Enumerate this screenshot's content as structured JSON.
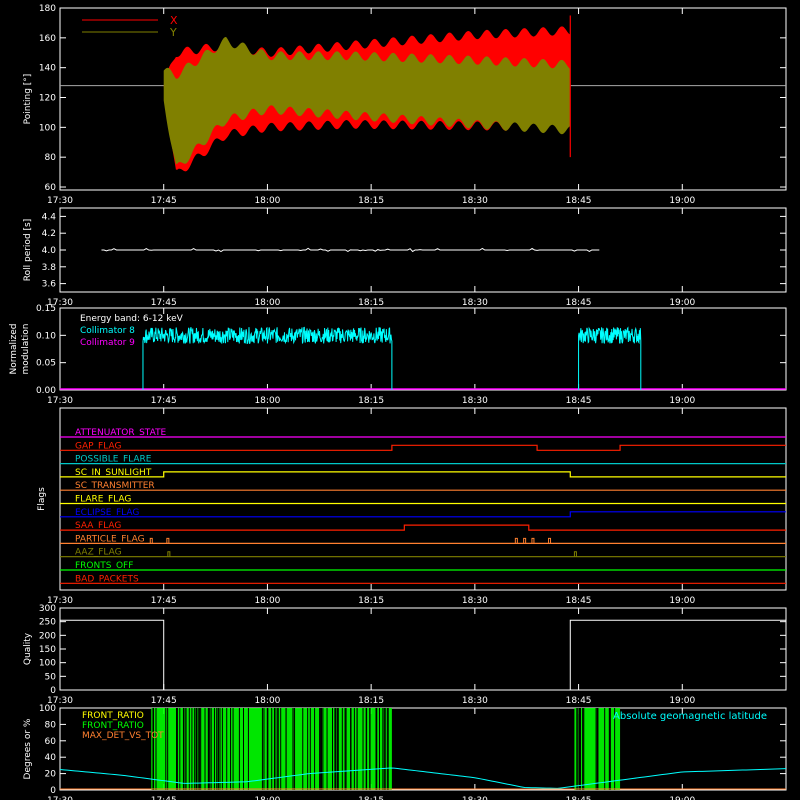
{
  "time_ticks": [
    "17:30",
    "17:45",
    "18:00",
    "18:15",
    "18:30",
    "18:45",
    "19:00"
  ],
  "chart_data": [
    {
      "type": "area",
      "panel": "pointing",
      "ylabel": "Pointing [°]",
      "ylim": [
        58,
        180
      ],
      "yticks": [
        60,
        80,
        100,
        120,
        140,
        160,
        180
      ],
      "reference_line": 128,
      "legend_placement": "top-left",
      "series": [
        {
          "name": "X",
          "color": "#ff0000",
          "band_min": [
            [
              17.75,
              128
            ],
            [
              17.78,
              68
            ],
            [
              17.9,
              95
            ],
            [
              18.0,
              100
            ],
            [
              18.2,
              102
            ],
            [
              18.5,
              101
            ],
            [
              18.73,
              100
            ]
          ],
          "band_max": [
            [
              17.75,
              128
            ],
            [
              17.78,
              150
            ],
            [
              17.9,
              155
            ],
            [
              18.0,
              150
            ],
            [
              18.2,
              155
            ],
            [
              18.5,
              162
            ],
            [
              18.73,
              165
            ]
          ]
        },
        {
          "name": "Y",
          "color": "#808000",
          "band_min": [
            [
              17.75,
              118
            ],
            [
              17.78,
              72
            ],
            [
              17.9,
              105
            ],
            [
              18.0,
              112
            ],
            [
              18.2,
              108
            ],
            [
              18.5,
              102
            ],
            [
              18.73,
              98
            ]
          ],
          "band_max": [
            [
              17.75,
              138
            ],
            [
              17.78,
              135
            ],
            [
              17.9,
              158
            ],
            [
              18.0,
              148
            ],
            [
              18.2,
              148
            ],
            [
              18.5,
              145
            ],
            [
              18.73,
              142
            ]
          ]
        }
      ]
    },
    {
      "type": "line",
      "panel": "roll_period",
      "ylabel": "Roll period [s]",
      "ylim": [
        3.5,
        4.5
      ],
      "yticks": [
        "3.6",
        "3.8",
        "4.0",
        "4.2",
        "4.4"
      ],
      "series": [
        {
          "color": "#ffffff",
          "value": 4.0,
          "x_range": [
            17.6,
            18.8
          ]
        }
      ]
    },
    {
      "type": "line",
      "panel": "modulation",
      "ylabel_lines": [
        "Normalized",
        "modulation"
      ],
      "ylim": [
        0,
        0.15
      ],
      "yticks": [
        "0.00",
        "0.05",
        "0.10",
        "0.15"
      ],
      "annotation": "Energy band: 6-12 keV",
      "series": [
        {
          "name": "Collimator 8",
          "color": "#00ffff",
          "mean": 0.1,
          "segments": [
            [
              17.7,
              18.3
            ],
            [
              18.75,
              18.9
            ]
          ]
        },
        {
          "name": "Collimator 9",
          "color": "#ff00ff",
          "value": 0.0
        }
      ]
    },
    {
      "type": "line",
      "panel": "flags",
      "ylabel": "Flags",
      "flags": [
        {
          "name": "ATTENUATOR_STATE",
          "color": "#ff00ff",
          "changes": []
        },
        {
          "name": "GAP_FLAG",
          "color": "#ff2000",
          "changes": [
            [
              17.7,
              1
            ],
            [
              18.3,
              2
            ],
            [
              18.65,
              1
            ],
            [
              18.85,
              2
            ]
          ]
        },
        {
          "name": "POSSIBLE_FLARE",
          "color": "#00c8c8",
          "changes": []
        },
        {
          "name": "SC_IN_SUNLIGHT",
          "color": "#ffff00",
          "changes": [
            [
              17.75,
              2
            ],
            [
              18.73,
              1
            ]
          ]
        },
        {
          "name": "SC_TRANSMITTER",
          "color": "#ff8030",
          "changes": []
        },
        {
          "name": "FLARE_FLAG",
          "color": "#ffff00",
          "changes": []
        },
        {
          "name": "ECLIPSE_FLAG",
          "color": "#0000ff",
          "changes": [
            [
              17.75,
              1
            ],
            [
              18.73,
              2
            ]
          ]
        },
        {
          "name": "SAA_FLAG",
          "color": "#ff2000",
          "changes": [
            [
              18.33,
              2
            ],
            [
              18.63,
              1
            ]
          ]
        },
        {
          "name": "PARTICLE_FLAG",
          "color": "#ff8030",
          "changes": []
        },
        {
          "name": "AAZ_FLAG",
          "color": "#808000",
          "changes": []
        },
        {
          "name": "FRONTS_OFF",
          "color": "#00ff00",
          "changes": []
        },
        {
          "name": "BAD_PACKETS",
          "color": "#ff2000",
          "changes": []
        }
      ]
    },
    {
      "type": "line",
      "panel": "quality",
      "ylabel": "Quality",
      "ylim": [
        0,
        300
      ],
      "yticks": [
        "0",
        "50",
        "100",
        "150",
        "200",
        "250",
        "300"
      ],
      "series": [
        {
          "color": "#ffffff",
          "points": [
            [
              17.5,
              255
            ],
            [
              17.75,
              255
            ],
            [
              17.75,
              0
            ],
            [
              18.73,
              0
            ],
            [
              18.73,
              255
            ],
            [
              19.25,
              255
            ]
          ]
        }
      ]
    },
    {
      "type": "line",
      "panel": "degrees",
      "ylabel": "Degrees or %",
      "ylim": [
        0,
        100
      ],
      "yticks": [
        "0",
        "20",
        "40",
        "60",
        "80",
        "100"
      ],
      "series": [
        {
          "name": "FRONT_RATIO",
          "color": "#ffff00"
        },
        {
          "name": "FRONT_RATIO",
          "color": "#00ff00",
          "segments": [
            [
              17.72,
              18.3
            ],
            [
              18.74,
              18.85
            ]
          ]
        },
        {
          "name": "MAX_DET_VS_TOT",
          "color": "#ff8030"
        },
        {
          "name": "Absolute geomagnetic latitude",
          "color": "#00ffff",
          "points": [
            [
              17.5,
              25
            ],
            [
              17.65,
              18
            ],
            [
              17.8,
              8
            ],
            [
              17.95,
              10
            ],
            [
              18.1,
              20
            ],
            [
              18.3,
              27
            ],
            [
              18.5,
              15
            ],
            [
              18.62,
              3
            ],
            [
              18.7,
              2
            ],
            [
              18.85,
              12
            ],
            [
              19.0,
              22
            ],
            [
              19.25,
              26
            ]
          ]
        }
      ]
    }
  ]
}
